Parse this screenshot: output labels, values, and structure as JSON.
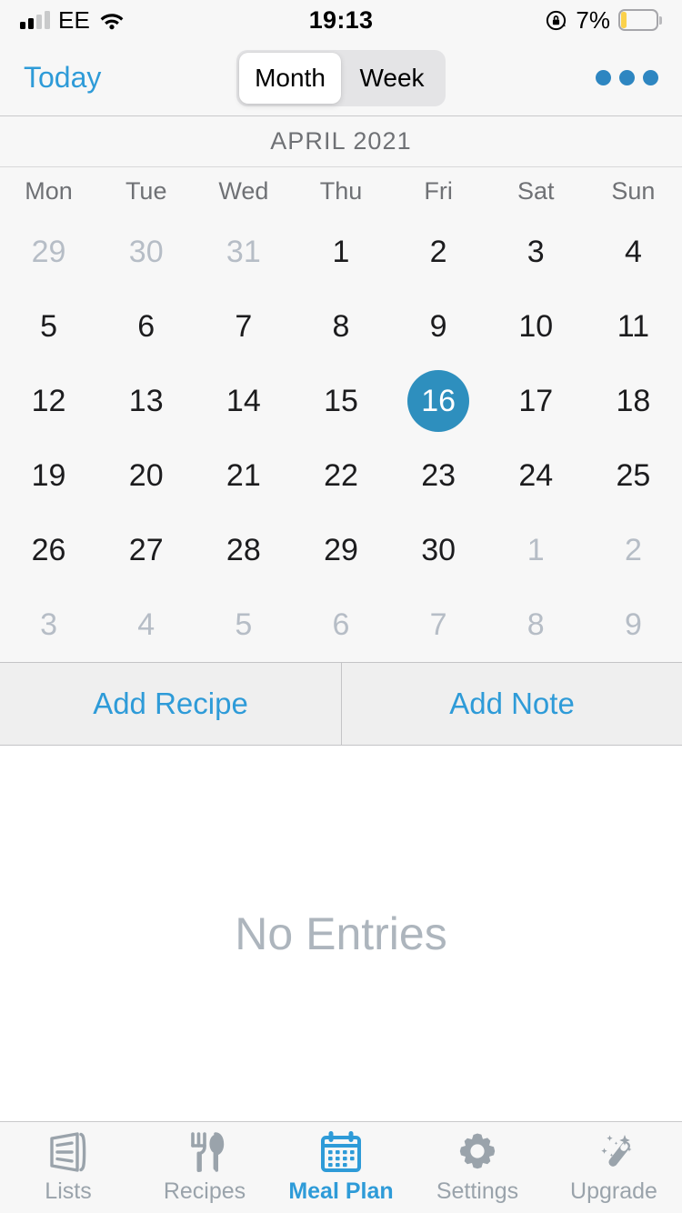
{
  "status_bar": {
    "carrier": "EE",
    "signal_bars_filled": 2,
    "signal_bars_total": 4,
    "wifi_icon": "wifi-icon",
    "time": "19:13",
    "rotation_lock_icon": "rotation-lock-icon",
    "battery_percent": "7%",
    "battery_level": 7,
    "battery_color": "#FBD14B"
  },
  "nav_bar": {
    "today_label": "Today",
    "segments": [
      {
        "label": "Month",
        "selected": true
      },
      {
        "label": "Week",
        "selected": false
      }
    ],
    "more_icon": "more-horizontal-icon"
  },
  "calendar": {
    "month_title": "APRIL 2021",
    "weekdays": [
      "Mon",
      "Tue",
      "Wed",
      "Thu",
      "Fri",
      "Sat",
      "Sun"
    ],
    "selected_day": 16,
    "selected_color": "#2E8FBE",
    "weeks": [
      [
        {
          "day": "29",
          "muted": true,
          "selected": false
        },
        {
          "day": "30",
          "muted": true,
          "selected": false
        },
        {
          "day": "31",
          "muted": true,
          "selected": false
        },
        {
          "day": "1",
          "muted": false,
          "selected": false
        },
        {
          "day": "2",
          "muted": false,
          "selected": false
        },
        {
          "day": "3",
          "muted": false,
          "selected": false
        },
        {
          "day": "4",
          "muted": false,
          "selected": false
        }
      ],
      [
        {
          "day": "5",
          "muted": false,
          "selected": false
        },
        {
          "day": "6",
          "muted": false,
          "selected": false
        },
        {
          "day": "7",
          "muted": false,
          "selected": false
        },
        {
          "day": "8",
          "muted": false,
          "selected": false
        },
        {
          "day": "9",
          "muted": false,
          "selected": false
        },
        {
          "day": "10",
          "muted": false,
          "selected": false
        },
        {
          "day": "11",
          "muted": false,
          "selected": false
        }
      ],
      [
        {
          "day": "12",
          "muted": false,
          "selected": false
        },
        {
          "day": "13",
          "muted": false,
          "selected": false
        },
        {
          "day": "14",
          "muted": false,
          "selected": false
        },
        {
          "day": "15",
          "muted": false,
          "selected": false
        },
        {
          "day": "16",
          "muted": false,
          "selected": true
        },
        {
          "day": "17",
          "muted": false,
          "selected": false
        },
        {
          "day": "18",
          "muted": false,
          "selected": false
        }
      ],
      [
        {
          "day": "19",
          "muted": false,
          "selected": false
        },
        {
          "day": "20",
          "muted": false,
          "selected": false
        },
        {
          "day": "21",
          "muted": false,
          "selected": false
        },
        {
          "day": "22",
          "muted": false,
          "selected": false
        },
        {
          "day": "23",
          "muted": false,
          "selected": false
        },
        {
          "day": "24",
          "muted": false,
          "selected": false
        },
        {
          "day": "25",
          "muted": false,
          "selected": false
        }
      ],
      [
        {
          "day": "26",
          "muted": false,
          "selected": false
        },
        {
          "day": "27",
          "muted": false,
          "selected": false
        },
        {
          "day": "28",
          "muted": false,
          "selected": false
        },
        {
          "day": "29",
          "muted": false,
          "selected": false
        },
        {
          "day": "30",
          "muted": false,
          "selected": false
        },
        {
          "day": "1",
          "muted": true,
          "selected": false
        },
        {
          "day": "2",
          "muted": true,
          "selected": false
        }
      ],
      [
        {
          "day": "3",
          "muted": true,
          "selected": false
        },
        {
          "day": "4",
          "muted": true,
          "selected": false
        },
        {
          "day": "5",
          "muted": true,
          "selected": false
        },
        {
          "day": "6",
          "muted": true,
          "selected": false
        },
        {
          "day": "7",
          "muted": true,
          "selected": false
        },
        {
          "day": "8",
          "muted": true,
          "selected": false
        },
        {
          "day": "9",
          "muted": true,
          "selected": false
        }
      ]
    ]
  },
  "actions": {
    "add_recipe_label": "Add Recipe",
    "add_note_label": "Add Note"
  },
  "content": {
    "empty_label": "No Entries"
  },
  "tab_bar": {
    "active_color": "#2E9BD8",
    "inactive_color": "#9AA3AB",
    "tabs": [
      {
        "label": "Lists",
        "icon": "lists-icon",
        "active": false
      },
      {
        "label": "Recipes",
        "icon": "fork-spoon-icon",
        "active": false
      },
      {
        "label": "Meal Plan",
        "icon": "calendar-icon",
        "active": true
      },
      {
        "label": "Settings",
        "icon": "gear-icon",
        "active": false
      },
      {
        "label": "Upgrade",
        "icon": "magic-wand-icon",
        "active": false
      }
    ]
  }
}
